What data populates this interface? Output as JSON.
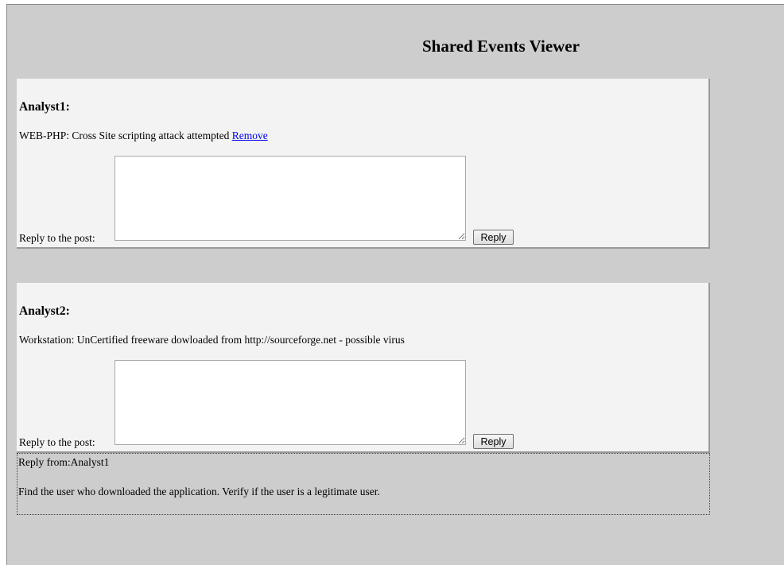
{
  "page": {
    "title": "Shared Events Viewer"
  },
  "posts": [
    {
      "author": "Analyst1:",
      "message": "WEB-PHP: Cross Site scripting attack attempted",
      "remove_link": "Remove",
      "reply_label": "Reply to the post:",
      "reply_value": "",
      "reply_button": "Reply"
    },
    {
      "author": "Analyst2:",
      "message": "Workstation: UnCertified freeware dowloaded from http://sourceforge.net - possible virus",
      "reply_label": "Reply to the post:",
      "reply_value": "",
      "reply_button": "Reply",
      "replies": [
        {
          "from": "Reply from:Analyst1",
          "text": "Find the user who downloaded the application. Verify if the user is a legitimate user."
        }
      ]
    }
  ]
}
